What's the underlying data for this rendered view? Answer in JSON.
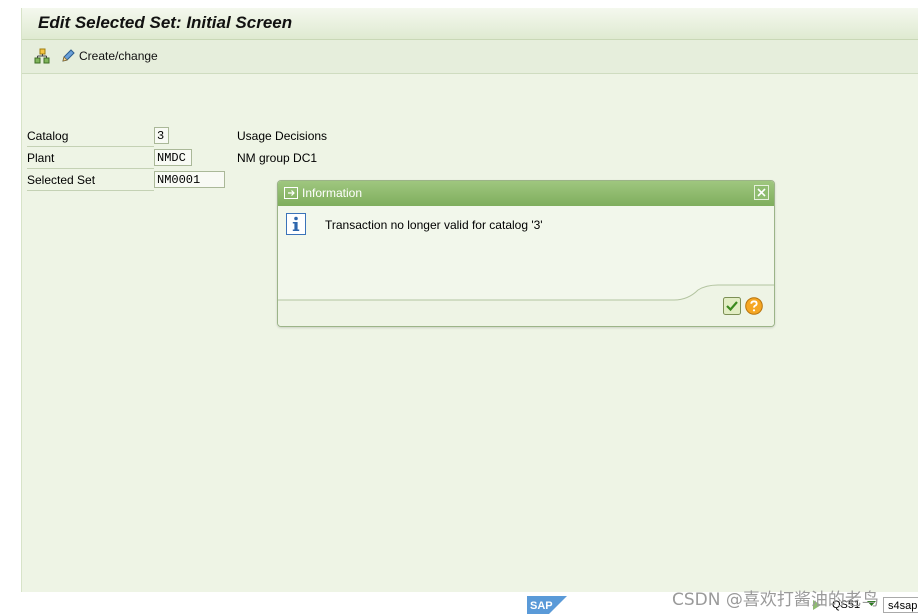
{
  "window": {
    "title": "Edit Selected Set: Initial Screen"
  },
  "toolbar": {
    "other_selected_set_icon": "hierarchy-icon",
    "create_change_label": "Create/change",
    "create_change_icon": "pencil-icon"
  },
  "form": {
    "catalog": {
      "label": "Catalog",
      "value": "3",
      "description": "Usage Decisions"
    },
    "plant": {
      "label": "Plant",
      "value": "NMDC",
      "description": "NM group DC1"
    },
    "selected_set": {
      "label": "Selected Set",
      "value": "NM0001"
    }
  },
  "dialog": {
    "title": "Information",
    "message": "Transaction no longer valid for catalog '3'",
    "icons": [
      "dialog-window-icon",
      "close-icon",
      "info-icon",
      "checkmark-icon",
      "help-icon"
    ]
  },
  "statusbar": {
    "tcode": "QS51",
    "server": "s4sap"
  },
  "watermark": "CSDN @喜欢打酱油的老鸟",
  "colors": {
    "header_green": "#8fbc70",
    "background": "#eef4e5",
    "ok_button": "#d9e8b0",
    "help_button": "#f5a623"
  }
}
